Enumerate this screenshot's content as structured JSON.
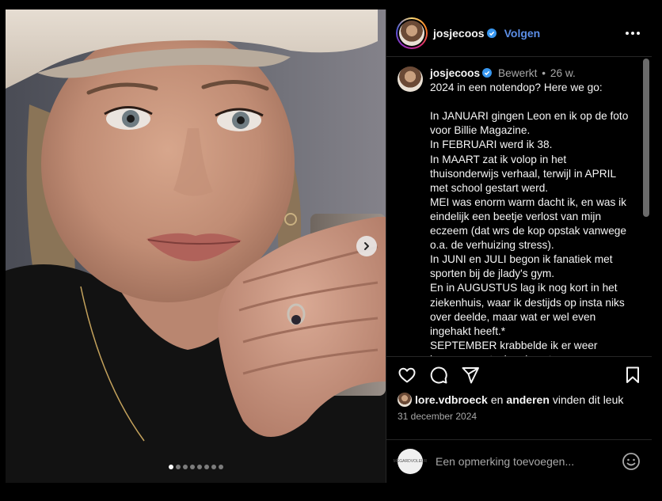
{
  "post": {
    "username": "josjecoos",
    "follow_label": "Volgen",
    "more_icon": "more-options-icon",
    "caption": {
      "username": "josjecoos",
      "edited": "Bewerkt",
      "separator": "•",
      "time": "26 w.",
      "text": "2024 in een notendop? Here we go:\n\nIn JANUARI gingen Leon en ik op de foto voor Billie Magazine.\nIn FEBRUARI werd ik 38.\nIn MAART zat ik volop in het thuisonderwijs verhaal, terwijl in APRIL met school gestart werd.\nMEI was enorm warm dacht ik, en was ik eindelijk een beetje verlost van mijn eczeem (dat wrs de kop opstak vanwege o.a. de verhuizing stress).\nIn JUNI en JULI begon ik fanatiek met sporten bij de jlady's gym.\nEn in AUGUSTUS lag ik nog kort in het ziekenhuis, waar ik destijds op insta niks over deelde, maar wat er wel even ingehakt heeft.*\nSEPTEMBER krabbelde ik er weer bovenop en toch ook met"
    },
    "likes": {
      "user": "lore.vdbroeck",
      "connector": "en",
      "others": "anderen",
      "suffix": "vinden dit leuk"
    },
    "date": "31 december 2024",
    "comment": {
      "placeholder": "Een opmerking toevoegen...",
      "avatar_text": "MEGARDVOLEUR"
    },
    "carousel": {
      "slide_count": 8,
      "active_index": 0
    }
  },
  "colors": {
    "background": "#000000",
    "follow": "#5c8ee6",
    "verified": "#3897f0",
    "muted": "#a8a8a8"
  }
}
